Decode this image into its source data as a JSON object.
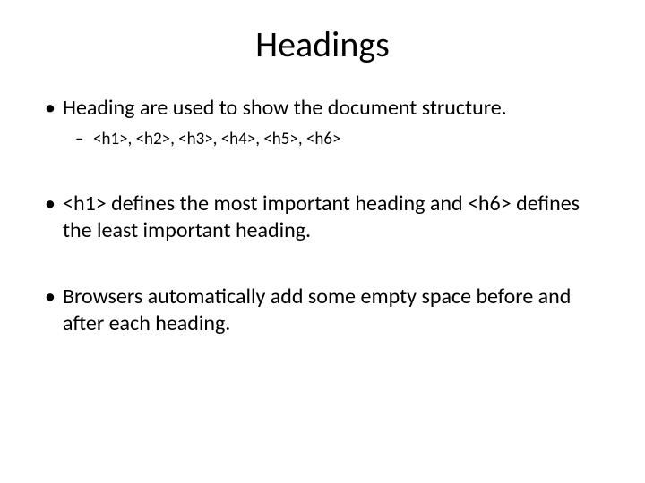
{
  "title": "Headings",
  "bullets": {
    "b1": "Heading are used to show the document structure.",
    "b1_sub": "<h1>, <h2>, <h3>, <h4>, <h5>, <h6>",
    "b2": "<h1> defines the most important heading and <h6> defines the least important heading.",
    "b3": "Browsers automatically add some empty space before and after each heading."
  }
}
